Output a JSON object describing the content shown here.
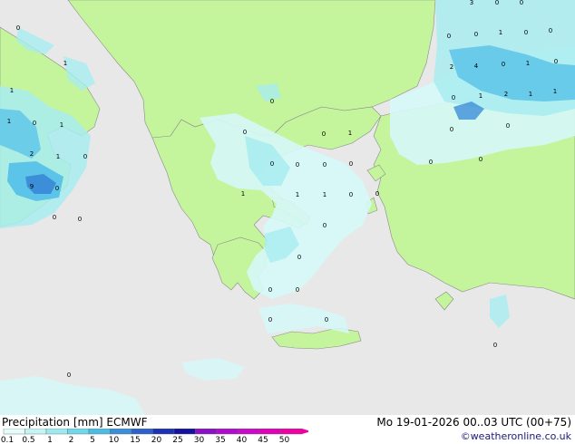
{
  "header": {
    "title": "Precipitation [mm]",
    "model": "ECMWF",
    "datetime": "Mo 19-01-2026 00..03 UTC (00+75)",
    "credit": "©weatheronline.co.uk"
  },
  "legend": {
    "ticks": [
      "0.1",
      "0.5",
      "1",
      "2",
      "5",
      "10",
      "15",
      "20",
      "25",
      "30",
      "35",
      "40",
      "45",
      "50"
    ],
    "colors": [
      "#e4fcfc",
      "#c4f4f4",
      "#9ceaf0",
      "#6ed8ea",
      "#4cbce4",
      "#3c8ed8",
      "#2c60cc",
      "#1c32b4",
      "#1410a0",
      "#8c10c8",
      "#b00cd0",
      "#cc08cc",
      "#e000b8",
      "#f000a4"
    ]
  },
  "map": {
    "colors": {
      "sea": "#e8e8e8",
      "land": "#c4f59c",
      "precip_light": "#d6f8f8",
      "precip_mid": "#a8ecf0",
      "precip_heavy": "#5cc4e8",
      "precip_strong": "#3c8ed8",
      "border": "#8a8a8a"
    },
    "values": [
      {
        "t": "3"
      },
      {
        "t": "0"
      },
      {
        "t": "0"
      },
      {
        "t": "0"
      },
      {
        "t": "0"
      },
      {
        "t": "0"
      },
      {
        "t": "1"
      },
      {
        "t": "0"
      },
      {
        "t": "0"
      },
      {
        "t": "1"
      },
      {
        "t": "2"
      },
      {
        "t": "4"
      },
      {
        "t": "0"
      },
      {
        "t": "1"
      },
      {
        "t": "0"
      },
      {
        "t": "1"
      },
      {
        "t": "1"
      },
      {
        "t": "2"
      },
      {
        "t": "1"
      },
      {
        "t": "1"
      },
      {
        "t": "0"
      },
      {
        "t": "0"
      },
      {
        "t": "0"
      },
      {
        "t": "0"
      },
      {
        "t": "1"
      },
      {
        "t": "0"
      },
      {
        "t": "1"
      },
      {
        "t": "1"
      },
      {
        "t": "2"
      },
      {
        "t": "1"
      },
      {
        "t": "0"
      },
      {
        "t": "9"
      },
      {
        "t": "0"
      },
      {
        "t": "0"
      },
      {
        "t": "0"
      },
      {
        "t": "0"
      },
      {
        "t": "0"
      },
      {
        "t": "0"
      },
      {
        "t": "0"
      },
      {
        "t": "1"
      },
      {
        "t": "0"
      },
      {
        "t": "0"
      },
      {
        "t": "1"
      },
      {
        "t": "1"
      },
      {
        "t": "0"
      },
      {
        "t": "0"
      },
      {
        "t": "0"
      },
      {
        "t": "0"
      },
      {
        "t": "0"
      },
      {
        "t": "0"
      },
      {
        "t": "0"
      },
      {
        "t": "0"
      },
      {
        "t": "0"
      },
      {
        "t": "0"
      },
      {
        "t": "0"
      },
      {
        "t": "0"
      }
    ]
  }
}
